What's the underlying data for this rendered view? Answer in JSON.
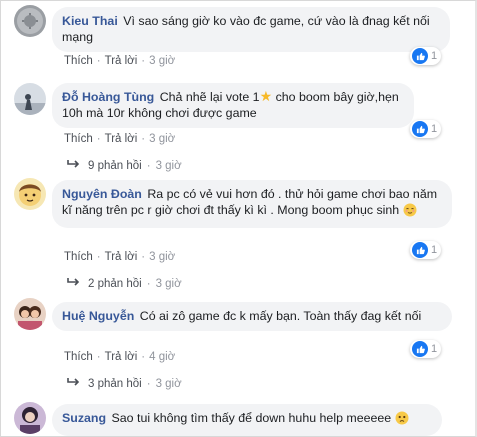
{
  "comments": [
    {
      "name": "Kieu Thai",
      "text": "Vì sao sáng giờ ko vào đc game, cứ vào là đnag kết nối mạng",
      "likes": "1",
      "like_label": "Thích",
      "reply_label": "Trả lời",
      "time": "3 giờ",
      "replies": ""
    },
    {
      "name": "Đỗ Hoàng Tùng",
      "text_before": "Chả nhẽ lại vote 1",
      "text_after": " cho boom bây giờ,hẹn 10h mà 10r không chơi được game",
      "likes": "1",
      "like_label": "Thích",
      "reply_label": "Trả lời",
      "time": "3 giờ",
      "replies": "9 phản hồi",
      "replies_time": "3 giờ"
    },
    {
      "name": "Nguyên Đoàn",
      "text": "Ra pc có vẻ vui hơn đó . thử hỏi game chơi bao năm kĩ năng trên pc r giờ chơi đt thấy kì kì . Mong boom phục sinh",
      "likes": "1",
      "like_label": "Thích",
      "reply_label": "Trả lời",
      "time": "3 giờ",
      "replies": "2 phản hồi",
      "replies_time": "3 giờ"
    },
    {
      "name": "Huệ Nguyễn",
      "text": "Có ai zô game đc k mấy bạn. Toàn thấy đag kết nối",
      "likes": "1",
      "like_label": "Thích",
      "reply_label": "Trả lời",
      "time": "4 giờ",
      "replies": "3 phản hồi",
      "replies_time": "3 giờ"
    },
    {
      "name": "Suzang",
      "text": "Sao tui không tìm thấy để down huhu help meeeee"
    }
  ],
  "colors": {
    "name": "#385898",
    "bubble": "#f2f3f5",
    "like": "#1877f2",
    "meta": "#90949c"
  },
  "icons": [
    "like-icon",
    "star-emoji",
    "relieved-emoji",
    "sad-emoji",
    "reply-arrow-icon"
  ]
}
